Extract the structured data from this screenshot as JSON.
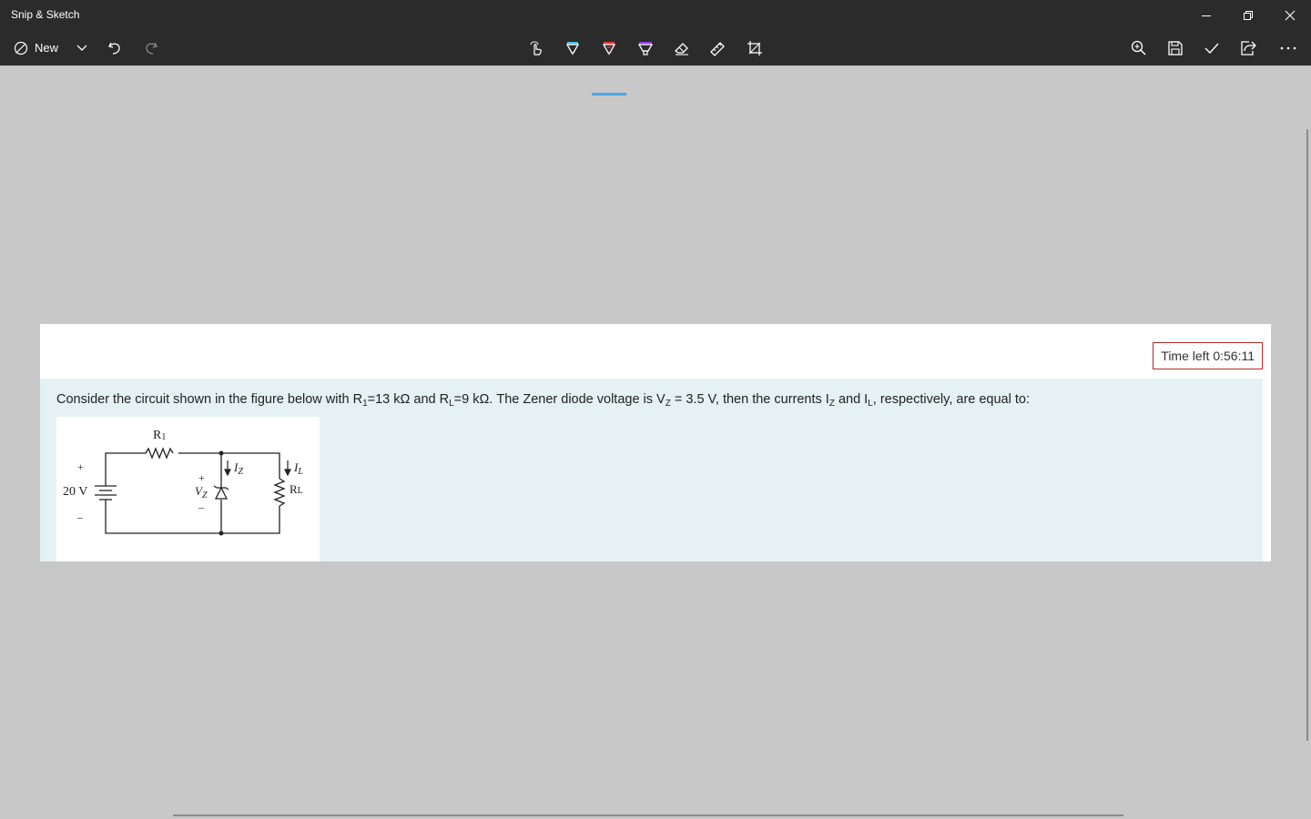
{
  "window": {
    "title": "Snip & Sketch",
    "controls": [
      "minimize-icon",
      "restore-icon",
      "close-icon"
    ]
  },
  "toolbar": {
    "new_label": "New",
    "left_icons": [
      "new-snip-icon",
      "chevron-down-icon",
      "undo-icon",
      "redo-icon"
    ],
    "center_icons": [
      "touch-writing-icon",
      "ballpoint-pen-icon",
      "pencil-icon",
      "highlighter-icon",
      "eraser-icon",
      "ruler-icon",
      "crop-icon"
    ],
    "active_tool": "pencil-icon",
    "right_icons": [
      "zoom-icon",
      "save-icon",
      "copy-check-icon",
      "share-icon",
      "more-icon"
    ],
    "colors": {
      "pen": "#40c4e0",
      "pencil": "#e83838",
      "highlighter": "#9a3cf0",
      "active_indicator": "#4aa6e8"
    }
  },
  "content": {
    "timer": "Time left 0:56:11",
    "question": {
      "p1": "Consider the circuit shown in the figure below with R",
      "s1": "1",
      "p2": "=13 kΩ and R",
      "s2": "L",
      "p3": "=9 kΩ. The Zener diode voltage is V",
      "s3": "Z",
      "p4": " = 3.5 V, then the currents I",
      "s4": "Z",
      "p5": " and I",
      "s5": "L",
      "p6": ", respectively, are equal to:"
    },
    "figure": {
      "r1_label": "R",
      "r1_sub": "1",
      "source_label": "20 V",
      "plus": "+",
      "minus": "–",
      "vz_label": "V",
      "vz_sub": "Z",
      "iz_label": "I",
      "iz_sub": "Z",
      "il_label": "I",
      "il_sub": "L",
      "rl_label": "R",
      "rl_sub": "L"
    }
  }
}
